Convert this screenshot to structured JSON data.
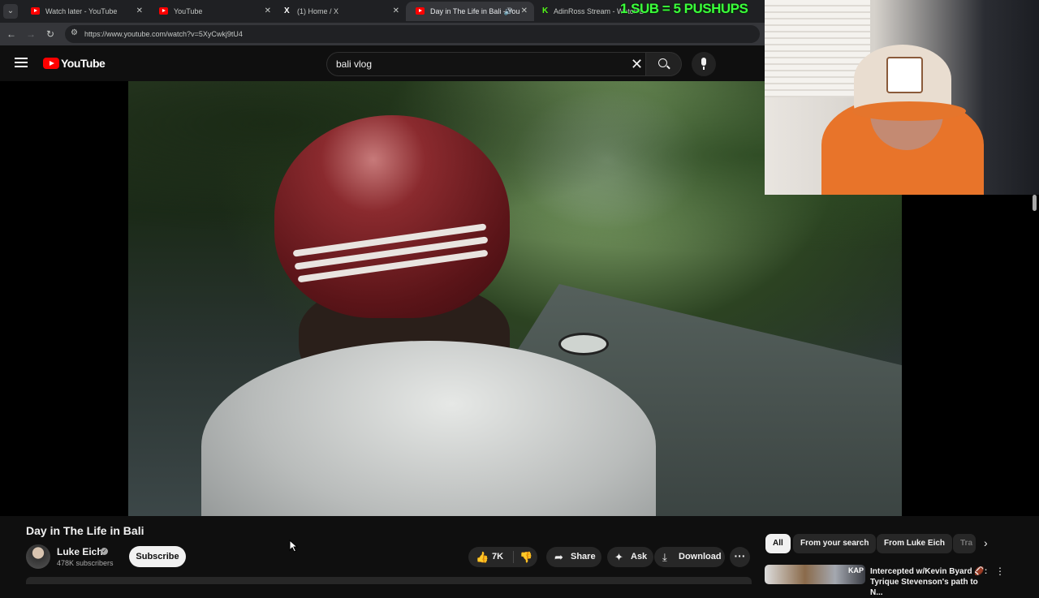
{
  "browser": {
    "tabs": [
      {
        "title": "Watch later - YouTube",
        "icon": "youtube-icon"
      },
      {
        "title": "YouTube",
        "icon": "youtube-icon"
      },
      {
        "title": "(1) Home / X",
        "icon": "x-icon"
      },
      {
        "title": "Day in The Life in Bali - You",
        "icon": "youtube-icon",
        "active": true
      },
      {
        "title": "AdinRoss Stream - Watch L",
        "icon": "kick-icon"
      }
    ],
    "url": "https://www.youtube.com/watch?v=5XyCwkj9tU4"
  },
  "stream_overlay": {
    "text": "1 SUB = 5 PUSHUPS",
    "color": "#3cff3c"
  },
  "youtube": {
    "logo_text": "YouTube",
    "search": {
      "value": "bali vlog"
    },
    "video": {
      "title": "Day in The Life in Bali",
      "channel": "Luke Eich",
      "subscribers": "478K subscribers",
      "subscribe_label": "Subscribe",
      "likes": "7K",
      "share_label": "Share",
      "ask_label": "Ask",
      "download_label": "Download"
    },
    "chips": [
      "All",
      "From your search",
      "From Luke Eich",
      "Tra"
    ],
    "recommendation": {
      "thumb_badge": "KAP",
      "title": "Intercepted w/Kevin Byard 🏈: Tyrique Stevenson's path to N..."
    }
  },
  "colors": {
    "accent": "#ff0000",
    "background": "#0f0f0f",
    "kick": "#53fc18"
  }
}
